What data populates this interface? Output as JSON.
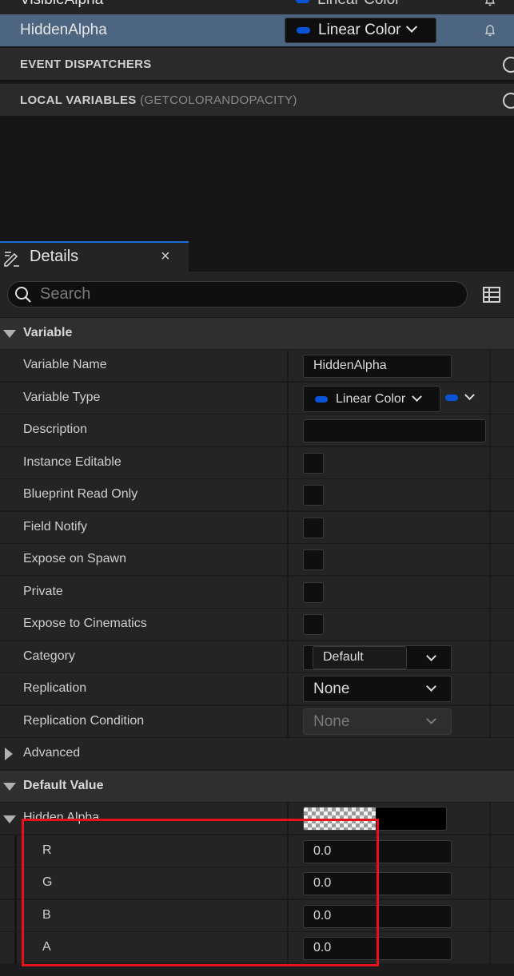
{
  "my_blueprint": {
    "variables": [
      {
        "name": "VisibleAlpha",
        "type": "Linear Color"
      },
      {
        "name": "HiddenAlpha",
        "type": "Linear Color"
      }
    ],
    "sections": {
      "event_dispatchers": "EVENT DISPATCHERS",
      "local_variables": "LOCAL VARIABLES",
      "local_variables_scope": "(GETCOLORANDOPACITY)"
    }
  },
  "details": {
    "tab_label": "Details",
    "tab_close": "×",
    "search_placeholder": "Search",
    "variable_category": "Variable",
    "properties": {
      "variable_name": {
        "label": "Variable Name",
        "value": "HiddenAlpha"
      },
      "variable_type": {
        "label": "Variable Type",
        "value": "Linear Color"
      },
      "description": {
        "label": "Description",
        "value": ""
      },
      "instance_editable": {
        "label": "Instance Editable"
      },
      "blueprint_read_only": {
        "label": "Blueprint Read Only"
      },
      "field_notify": {
        "label": "Field Notify"
      },
      "expose_on_spawn": {
        "label": "Expose on Spawn"
      },
      "private": {
        "label": "Private"
      },
      "expose_to_cinematics": {
        "label": "Expose to Cinematics"
      },
      "category": {
        "label": "Category",
        "value": "Default"
      },
      "replication": {
        "label": "Replication",
        "value": "None"
      },
      "replication_condition": {
        "label": "Replication Condition",
        "value": "None"
      }
    },
    "advanced_label": "Advanced",
    "default_value_category": "Default Value",
    "default_value": {
      "label": "Hidden Alpha",
      "components": [
        {
          "label": "R",
          "value": "0.0"
        },
        {
          "label": "G",
          "value": "0.0"
        },
        {
          "label": "B",
          "value": "0.0"
        },
        {
          "label": "A",
          "value": "0.0"
        }
      ]
    }
  },
  "colors": {
    "selection": "#4c6581",
    "pin_linear_color": "#0b53d6",
    "highlight": "#e8101a",
    "tab_accent": "#1a6ed8"
  }
}
